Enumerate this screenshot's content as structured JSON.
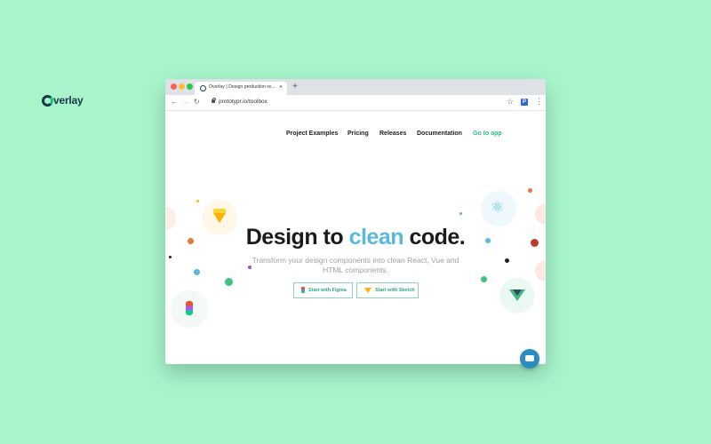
{
  "browser": {
    "tab_title": "Overlay | Design production ready",
    "tab_close": "×",
    "new_tab": "+",
    "back": "←",
    "forward": "→",
    "reload": "↻",
    "url": "prototypr.io/toolbox",
    "bookmark": "☆",
    "extension": "P",
    "menu": "⋮"
  },
  "site": {
    "logo_text": "verlay",
    "nav": [
      "Project Examples",
      "Pricing",
      "Releases",
      "Documentation",
      "Go to app"
    ]
  },
  "hero": {
    "title_before": "Design to ",
    "title_accent": "clean",
    "title_after": " code.",
    "subtitle": "Transform your design components into clean React, Vue and HTML components."
  },
  "buttons": {
    "figma": "Start with Figma",
    "sketch": "Start with Sketch"
  },
  "icons": {
    "react": "⚛"
  },
  "colors": {
    "background": "#a8f5cc",
    "accent_green": "#2fbf85",
    "accent_blue": "#5ab8df",
    "chat": "#2b8cc4"
  }
}
